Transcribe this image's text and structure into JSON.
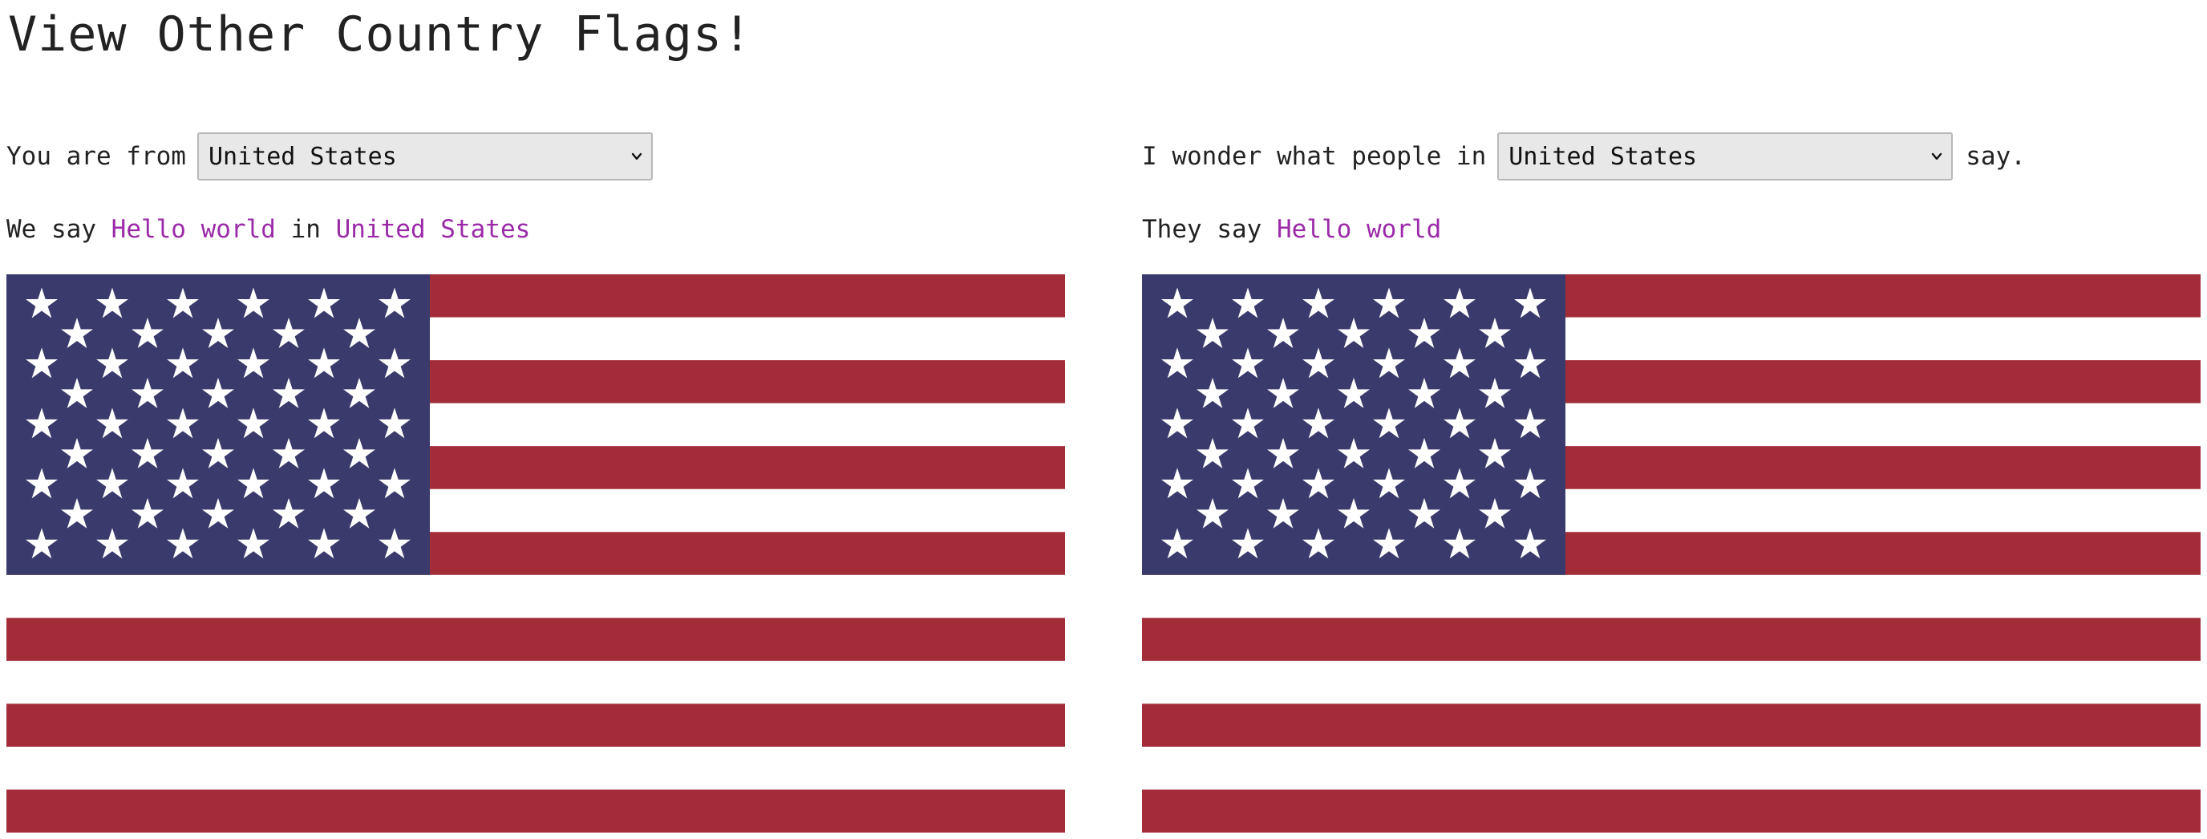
{
  "page": {
    "title": "View Other Country Flags!"
  },
  "left": {
    "label": "You are from",
    "selected_country": "United States",
    "greeting_prefix": "We say",
    "greeting_phrase": "Hello world",
    "greeting_connector": "in",
    "greeting_country": "United States"
  },
  "right": {
    "label": "I wonder what people in",
    "selected_country": "United States",
    "suffix": "say.",
    "greeting_prefix": "They say",
    "greeting_phrase": "Hello world"
  },
  "flag": {
    "country": "United States",
    "stripes": 13,
    "star_rows": 9,
    "colors": {
      "red": "#a22d38",
      "white": "#ffffff",
      "blue": "#3b3a6c"
    }
  },
  "colors": {
    "highlight": "#9b2aa8",
    "text": "#222222",
    "select_bg": "#e8e8e9"
  },
  "icons": {
    "dropdown": "chevron-down-icon"
  }
}
